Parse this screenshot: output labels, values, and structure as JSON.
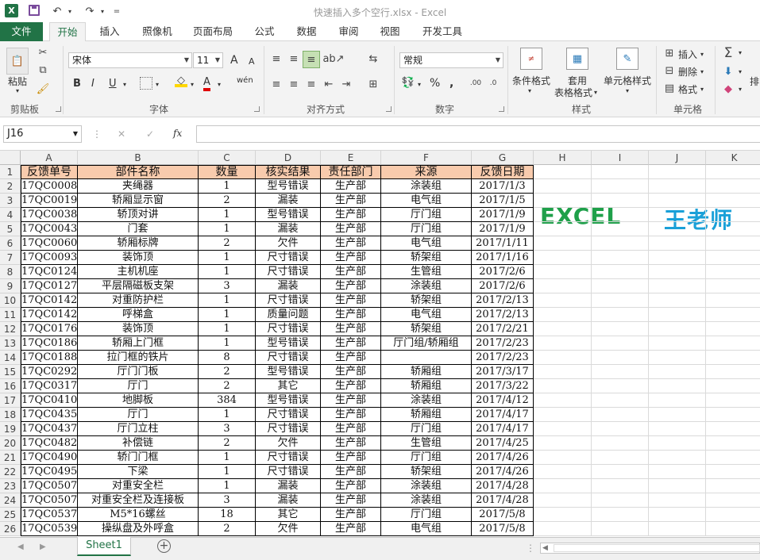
{
  "app": {
    "title": "快速插入多个空行.xlsx - Excel",
    "logo_letter": "X"
  },
  "quick_access": {
    "undo_label": "↶",
    "redo_label": "↷",
    "customize_label": "="
  },
  "tabs": [
    {
      "label": "文件"
    },
    {
      "label": "开始"
    },
    {
      "label": "插入"
    },
    {
      "label": "照像机"
    },
    {
      "label": "页面布局"
    },
    {
      "label": "公式"
    },
    {
      "label": "数据"
    },
    {
      "label": "审阅"
    },
    {
      "label": "视图"
    },
    {
      "label": "开发工具"
    }
  ],
  "ribbon": {
    "clipboard": {
      "paste": "粘贴",
      "group": "剪贴板"
    },
    "font": {
      "name": "宋体",
      "size": "11",
      "group": "字体",
      "grow": "A",
      "shrink": "A",
      "bold": "B",
      "italic": "I",
      "underline": "U",
      "wen": "wén"
    },
    "alignment": {
      "group": "对齐方式"
    },
    "number": {
      "format": "常规",
      "percent": "%",
      "comma": ",",
      "group": "数字"
    },
    "styles": {
      "conditional": "条件格式",
      "table_format_1": "套用",
      "table_format_2": "表格格式",
      "cell_styles": "单元格样式",
      "group": "样式"
    },
    "cells": {
      "insert": "插入",
      "delete": "删除",
      "format": "格式",
      "group": "单元格"
    },
    "editing": {
      "sort": "排"
    }
  },
  "formula_bar": {
    "name_box": "J16",
    "cancel": "✕",
    "enter": "✓",
    "fx": "fx",
    "value": ""
  },
  "columns": [
    "A",
    "B",
    "C",
    "D",
    "E",
    "F",
    "G",
    "H",
    "I",
    "J",
    "K"
  ],
  "header_row": [
    "反馈单号",
    "部件名称",
    "数量",
    "核实结果",
    "责任部门",
    "来源",
    "反馈日期"
  ],
  "rows": [
    [
      "17QC0008",
      "夹绳器",
      "1",
      "型号错误",
      "生产部",
      "涂装组",
      "2017/1/3"
    ],
    [
      "17QC0019",
      "轿厢显示窗",
      "2",
      "漏装",
      "生产部",
      "电气组",
      "2017/1/5"
    ],
    [
      "17QC0038",
      "轿顶对讲",
      "1",
      "型号错误",
      "生产部",
      "厅门组",
      "2017/1/9"
    ],
    [
      "17QC0043",
      "门套",
      "1",
      "漏装",
      "生产部",
      "厅门组",
      "2017/1/9"
    ],
    [
      "17QC0060",
      "轿厢标牌",
      "2",
      "欠件",
      "生产部",
      "电气组",
      "2017/1/11"
    ],
    [
      "17QC0093",
      "装饰顶",
      "1",
      "尺寸错误",
      "生产部",
      "轿架组",
      "2017/1/16"
    ],
    [
      "17QC0124",
      "主机机座",
      "1",
      "尺寸错误",
      "生产部",
      "生管组",
      "2017/2/6"
    ],
    [
      "17QC0127",
      "平层隔磁板支架",
      "3",
      "漏装",
      "生产部",
      "涂装组",
      "2017/2/6"
    ],
    [
      "17QC0142",
      "对重防护栏",
      "1",
      "尺寸错误",
      "生产部",
      "轿架组",
      "2017/2/13"
    ],
    [
      "17QC0142",
      "呼梯盒",
      "1",
      "质量问题",
      "生产部",
      "电气组",
      "2017/2/13"
    ],
    [
      "17QC0176",
      "装饰顶",
      "1",
      "尺寸错误",
      "生产部",
      "轿架组",
      "2017/2/21"
    ],
    [
      "17QC0186",
      "轿厢上门框",
      "1",
      "型号错误",
      "生产部",
      "厅门组/轿厢组",
      "2017/2/23"
    ],
    [
      "17QC0188",
      "拉门框的铁片",
      "8",
      "尺寸错误",
      "生产部",
      "",
      "2017/2/23"
    ],
    [
      "17QC0292",
      "厅门门板",
      "2",
      "型号错误",
      "生产部",
      "轿厢组",
      "2017/3/17"
    ],
    [
      "17QC0317",
      "厅门",
      "2",
      "其它",
      "生产部",
      "轿厢组",
      "2017/3/22"
    ],
    [
      "17QC0410",
      "地脚板",
      "384",
      "型号错误",
      "生产部",
      "涂装组",
      "2017/4/12"
    ],
    [
      "17QC0435",
      "厅门",
      "1",
      "尺寸错误",
      "生产部",
      "轿厢组",
      "2017/4/17"
    ],
    [
      "17QC0437",
      "厅门立柱",
      "3",
      "尺寸错误",
      "生产部",
      "厅门组",
      "2017/4/17"
    ],
    [
      "17QC0482",
      "补偿链",
      "2",
      "欠件",
      "生产部",
      "生管组",
      "2017/4/25"
    ],
    [
      "17QC0490",
      "轿门门框",
      "1",
      "尺寸错误",
      "生产部",
      "厅门组",
      "2017/4/26"
    ],
    [
      "17QC0495",
      "下梁",
      "1",
      "尺寸错误",
      "生产部",
      "轿架组",
      "2017/4/26"
    ],
    [
      "17QC0507",
      "对重安全栏",
      "1",
      "漏装",
      "生产部",
      "涂装组",
      "2017/4/28"
    ],
    [
      "17QC0507",
      "对重安全栏及连接板",
      "3",
      "漏装",
      "生产部",
      "涂装组",
      "2017/4/28"
    ],
    [
      "17QC0537",
      "M5*16螺丝",
      "18",
      "其它",
      "生产部",
      "厅门组",
      "2017/5/8"
    ],
    [
      "17QC0539",
      "操纵盘及外呼盒",
      "2",
      "欠件",
      "生产部",
      "电气组",
      "2017/5/8"
    ]
  ],
  "overlay": {
    "left_text": "EXCEL",
    "right_text": "王老师",
    "left_color": "#1fa04a",
    "right_color": "#1aa0d8"
  },
  "colors": {
    "accent": "#217346",
    "header_fill": "#f8cbad"
  },
  "sheets": [
    {
      "label": "Sheet1"
    }
  ],
  "add_sheet": "+"
}
